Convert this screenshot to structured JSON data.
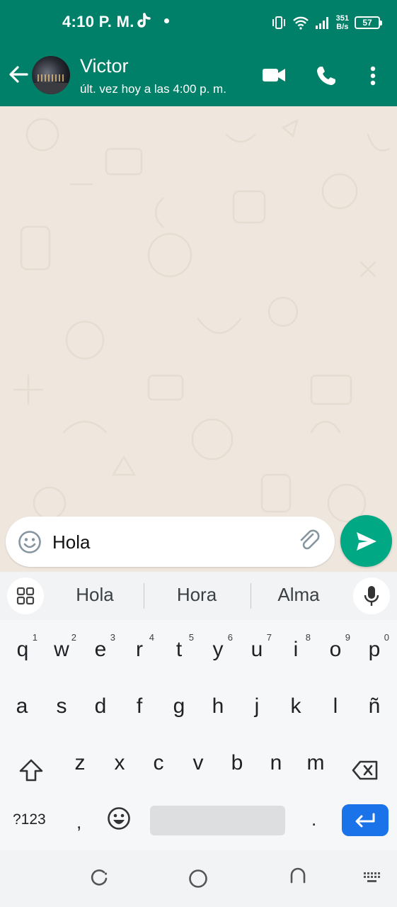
{
  "status_bar": {
    "time": "4:10 P. M.",
    "net_speed_value": "351",
    "net_speed_unit": "B/s",
    "battery": "57",
    "icons": [
      "tiktok-icon",
      "vibrate-icon",
      "wifi-icon",
      "signal-icon",
      "battery-icon"
    ]
  },
  "header": {
    "contact_name": "Victor",
    "last_seen": "últ. vez hoy a las 4:00 p. m.",
    "icons": [
      "back-arrow-icon",
      "video-call-icon",
      "voice-call-icon",
      "more-options-icon"
    ]
  },
  "compose": {
    "message_text": "Hola",
    "icons": [
      "emoji-icon",
      "attach-icon",
      "send-icon"
    ]
  },
  "keyboard": {
    "suggestions": [
      "Hola",
      "Hora",
      "Alma"
    ],
    "row1": [
      {
        "key": "q",
        "hint": "1"
      },
      {
        "key": "w",
        "hint": "2"
      },
      {
        "key": "e",
        "hint": "3"
      },
      {
        "key": "r",
        "hint": "4"
      },
      {
        "key": "t",
        "hint": "5"
      },
      {
        "key": "y",
        "hint": "6"
      },
      {
        "key": "u",
        "hint": "7"
      },
      {
        "key": "i",
        "hint": "8"
      },
      {
        "key": "o",
        "hint": "9"
      },
      {
        "key": "p",
        "hint": "0"
      }
    ],
    "row2": [
      "a",
      "s",
      "d",
      "f",
      "g",
      "h",
      "j",
      "k",
      "l",
      "ñ"
    ],
    "row3": [
      "z",
      "x",
      "c",
      "v",
      "b",
      "n",
      "m"
    ],
    "symbols_label": "?123",
    "comma": ",",
    "period": ".",
    "accent_color": "#1a73e8"
  },
  "theme": {
    "header_color": "#008069",
    "send_button_color": "#00a884",
    "chat_background": "#efe7de"
  }
}
